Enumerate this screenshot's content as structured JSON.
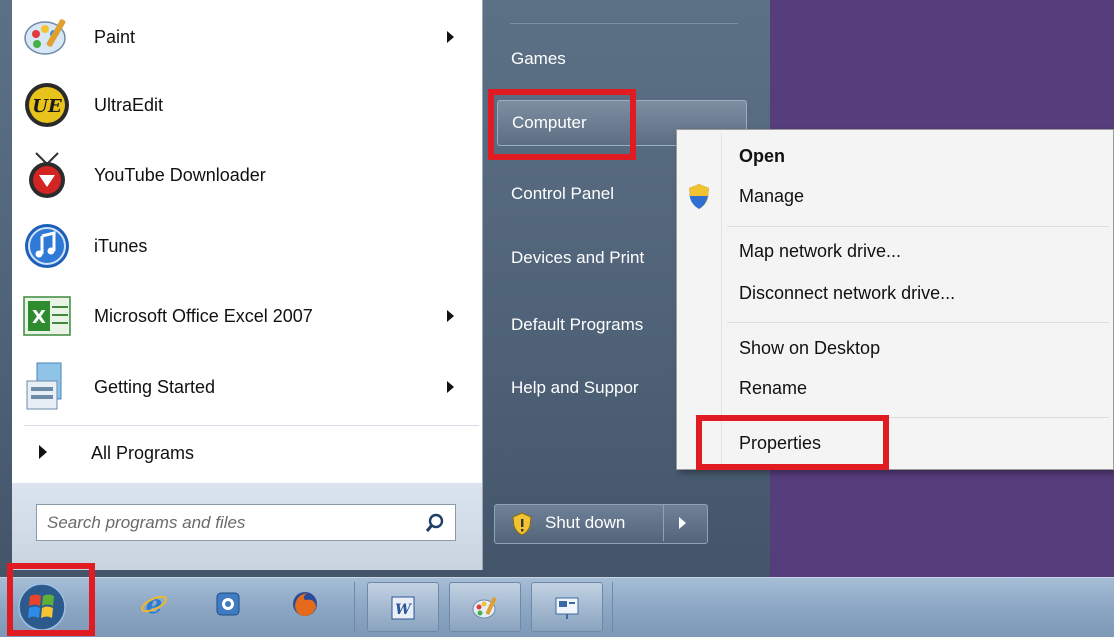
{
  "start_menu": {
    "programs": [
      {
        "label": "Paint",
        "icon": "paint-icon",
        "has_submenu": true
      },
      {
        "label": "UltraEdit",
        "icon": "ultraedit-icon",
        "has_submenu": false
      },
      {
        "label": "YouTube Downloader",
        "icon": "youtube-downloader-icon",
        "has_submenu": false
      },
      {
        "label": "iTunes",
        "icon": "itunes-icon",
        "has_submenu": false
      },
      {
        "label": "Microsoft Office Excel 2007",
        "icon": "excel-icon",
        "has_submenu": true
      },
      {
        "label": "Getting Started",
        "icon": "getting-started-icon",
        "has_submenu": true
      }
    ],
    "all_programs_label": "All Programs",
    "search_placeholder": "Search programs and files",
    "right_items": [
      {
        "label": "Games"
      },
      {
        "label": "Computer"
      },
      {
        "label": "Control Panel"
      },
      {
        "label": "Devices and Print"
      },
      {
        "label": "Default Programs"
      },
      {
        "label": "Help and Suppor"
      }
    ],
    "shutdown_label": "Shut down"
  },
  "context_menu": {
    "items": [
      {
        "label": "Open",
        "bold": true
      },
      {
        "label": "Manage",
        "icon": "uac-shield-icon"
      },
      {
        "label": "Map network drive..."
      },
      {
        "label": "Disconnect network drive..."
      },
      {
        "label": "Show on Desktop"
      },
      {
        "label": "Rename"
      },
      {
        "label": "Properties"
      }
    ]
  },
  "taskbar": {
    "pinned": [
      "internet-explorer-icon",
      "apps-icon",
      "firefox-icon",
      "word-icon",
      "paint-icon",
      "presentation-icon"
    ]
  },
  "colors": {
    "highlight": "#e11b22",
    "desktop": "#563d7c"
  }
}
